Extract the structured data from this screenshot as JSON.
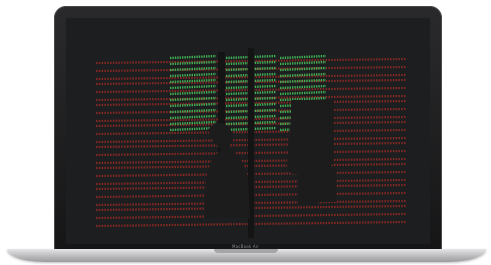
{
  "device": {
    "type": "laptop",
    "model_label": "MacBook Air",
    "bezel_color": "#1b1b1c",
    "body_color": "#c9c9cc"
  },
  "screen": {
    "background": "#1d1e1f",
    "colors": {
      "red_dots": "#8a2a24",
      "green_dots": "#3fae55",
      "silhouette": "#1c1c1d"
    }
  }
}
